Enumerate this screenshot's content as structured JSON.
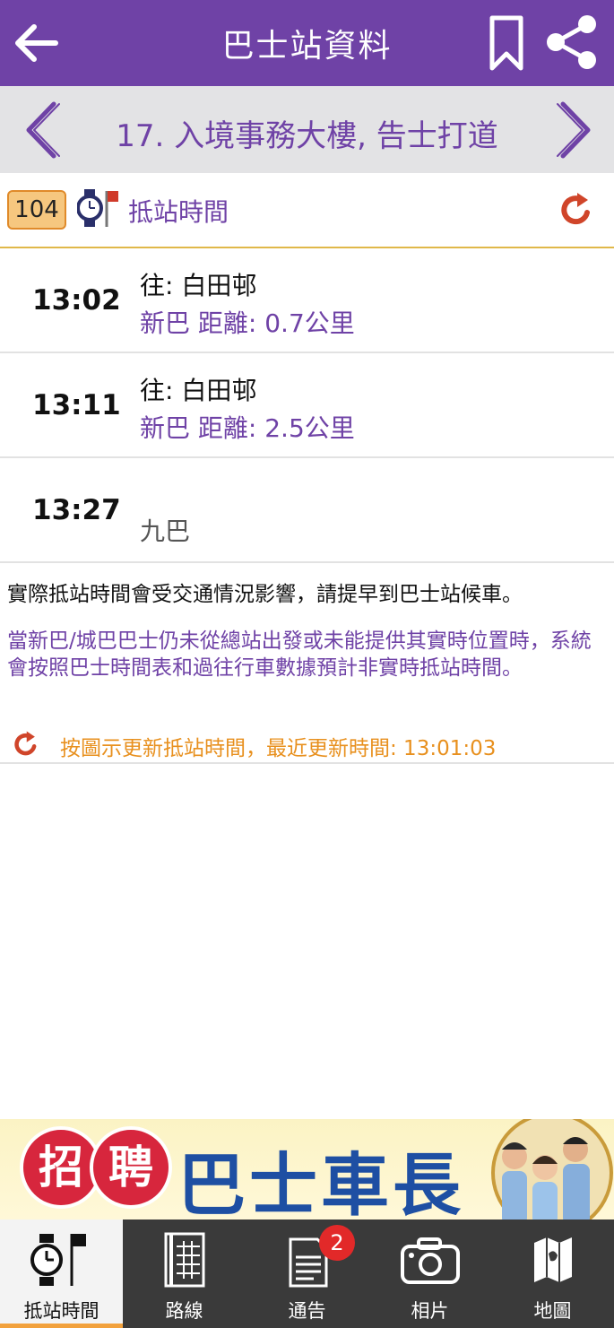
{
  "header": {
    "title": "巴士站資料",
    "back_icon": "arrow-left-icon",
    "bookmark_icon": "bookmark-icon",
    "share_icon": "share-icon"
  },
  "stop_nav": {
    "stop_name": "17. 入境事務大樓, 告士打道",
    "prev_icon": "chevron-left-icon",
    "next_icon": "chevron-right-icon"
  },
  "route_header": {
    "route_number": "104",
    "title": "抵站時間",
    "refresh_icon": "refresh-icon"
  },
  "etas": [
    {
      "time": "13:02",
      "destination": "往: 白田邨",
      "info": "新巴 距離: 0.7公里"
    },
    {
      "time": "13:11",
      "destination": "往: 白田邨",
      "info": "新巴 距離: 2.5公里"
    },
    {
      "time": "13:27",
      "destination": "",
      "info": "九巴"
    }
  ],
  "notes": {
    "note_traffic": "實際抵站時間會受交通情況影響，請提早到巴士站候車。",
    "note_schedule": "當新巴/城巴巴士仍未從總站出發或未能提供其實時位置時，系統會按照巴士時間表和過往行車數據預計非實時抵站時間。",
    "update_text": "按圖示更新抵站時間，最近更新時間: 13:01:03"
  },
  "banner": {
    "char_1": "招",
    "char_2": "聘",
    "headline": "巴士車長"
  },
  "bottom_nav": {
    "items": [
      {
        "label": "抵站時間",
        "icon": "watch-flag-icon",
        "active": true
      },
      {
        "label": "路線",
        "icon": "timetable-icon"
      },
      {
        "label": "通告",
        "icon": "notice-icon",
        "badge": "2"
      },
      {
        "label": "相片",
        "icon": "camera-icon"
      },
      {
        "label": "地圖",
        "icon": "map-icon"
      }
    ]
  },
  "colors": {
    "primary_purple": "#6f42a6",
    "accent_orange": "#e8901e",
    "refresh_red": "#d0452a",
    "nav_dark": "#3a3a3a"
  }
}
